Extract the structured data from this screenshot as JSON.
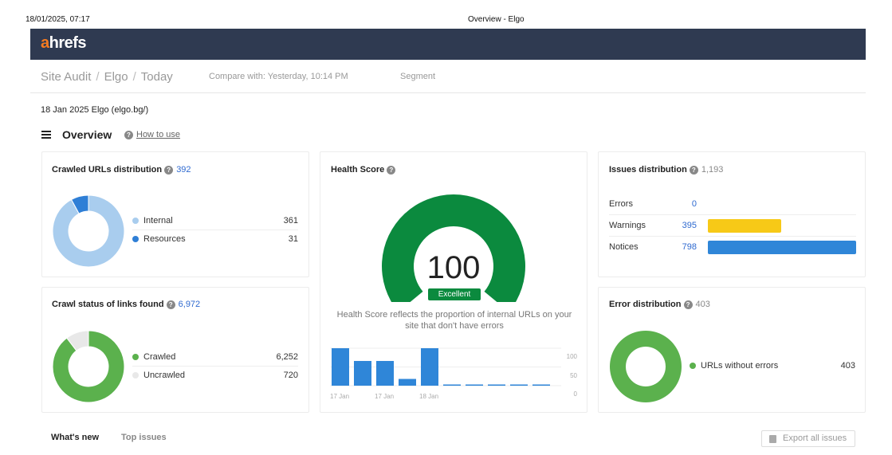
{
  "print_header": {
    "datetime": "18/01/2025, 07:17",
    "title": "Overview - Elgo"
  },
  "brand": {
    "logo_a": "a",
    "logo_rest": "hrefs",
    "bar_color": "#2f3a51",
    "accent": "#f57b20"
  },
  "breadcrumb": [
    "Site Audit",
    "Elgo",
    "Today"
  ],
  "compare": "Compare with: Yesterday, 10:14 PM",
  "segment": "Segment",
  "project_line": "18 Jan 2025 Elgo (elgo.bg/)",
  "overview": {
    "title": "Overview",
    "help_icon": "question-circle-icon",
    "how_to_use": "How to use"
  },
  "crawled_urls": {
    "title": "Crawled URLs distribution",
    "count": "392",
    "items": [
      {
        "label": "Internal",
        "value": "361",
        "color": "#a9cdee"
      },
      {
        "label": "Resources",
        "value": "31",
        "color": "#2f7fd6"
      }
    ],
    "chart_data": {
      "type": "pie",
      "categories": [
        "Internal",
        "Resources"
      ],
      "values": [
        361,
        31
      ]
    }
  },
  "crawl_status": {
    "title": "Crawl status of links found",
    "count": "6,972",
    "items": [
      {
        "label": "Crawled",
        "value": "6,252",
        "color": "#5bb14d"
      },
      {
        "label": "Uncrawled",
        "value": "720",
        "color": "#e8e8e8"
      }
    ],
    "chart_data": {
      "type": "pie",
      "categories": [
        "Crawled",
        "Uncrawled"
      ],
      "values": [
        6252,
        720
      ]
    }
  },
  "health_score": {
    "title": "Health Score",
    "score": "100",
    "badge": "Excellent",
    "description": "Health Score reflects the proportion of internal URLs on your site that don't have errors",
    "gauge_color": "#0b8a3e",
    "history": {
      "chart_data": {
        "type": "bar",
        "values": [
          100,
          66,
          66,
          18,
          100,
          1,
          1,
          1,
          1,
          1
        ],
        "ylim": [
          0,
          100
        ],
        "y_ticks": [
          "100",
          "50",
          "0"
        ],
        "x_ticks": [
          "17 Jan",
          "17 Jan",
          "18 Jan"
        ]
      }
    }
  },
  "issues": {
    "title": "Issues distribution",
    "count": "1,193",
    "rows": [
      {
        "label": "Errors",
        "value": "0",
        "amount": 0,
        "color": "#e0463d"
      },
      {
        "label": "Warnings",
        "value": "395",
        "amount": 395,
        "color": "#f7c917"
      },
      {
        "label": "Notices",
        "value": "798",
        "amount": 798,
        "color": "#2f86d8"
      }
    ]
  },
  "errors_dist": {
    "title": "Error distribution",
    "count": "403",
    "items": [
      {
        "label": "URLs without errors",
        "value": "403",
        "color": "#5bb14d"
      }
    ],
    "chart_data": {
      "type": "pie",
      "categories": [
        "URLs without errors"
      ],
      "values": [
        403
      ]
    }
  },
  "bottom_tabs": [
    "What's new",
    "Top issues"
  ],
  "export_label": "Export all issues"
}
